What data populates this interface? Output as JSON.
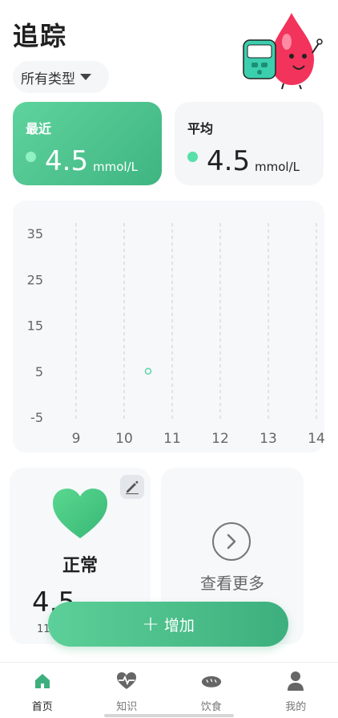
{
  "header": {
    "title": "追踪"
  },
  "filter": {
    "label": "所有类型"
  },
  "recent": {
    "label": "最近",
    "value": "4.5",
    "unit": "mmol/L"
  },
  "average": {
    "label": "平均",
    "value": "4.5",
    "unit": "mmol/L"
  },
  "chart_data": {
    "type": "scatter",
    "x_ticks": [
      "9",
      "10",
      "11",
      "12",
      "13",
      "14"
    ],
    "y_ticks": [
      "35",
      "25",
      "15",
      "5",
      "-5"
    ],
    "xlim": [
      9,
      14
    ],
    "ylim": [
      -5,
      35
    ],
    "points": [
      {
        "x": 10.5,
        "y": 5
      }
    ],
    "grid": "vertical-dashed",
    "colors": {
      "point": "#5ad6a6",
      "grid": "#c9ccd0"
    }
  },
  "health_card": {
    "status": "正常",
    "value": "4.5",
    "time": "11"
  },
  "more_card": {
    "label": "查看更多"
  },
  "add_button": {
    "label": "增加"
  },
  "tabs": [
    {
      "label": "首页",
      "icon": "home-icon",
      "active": true
    },
    {
      "label": "知识",
      "icon": "heartbeat-icon",
      "active": false
    },
    {
      "label": "饮食",
      "icon": "bread-icon",
      "active": false
    },
    {
      "label": "我的",
      "icon": "user-icon",
      "active": false
    }
  ],
  "colors": {
    "accent": "#48c08a",
    "accent_dark": "#3daf7e",
    "card_bg": "#f6f8fa"
  }
}
